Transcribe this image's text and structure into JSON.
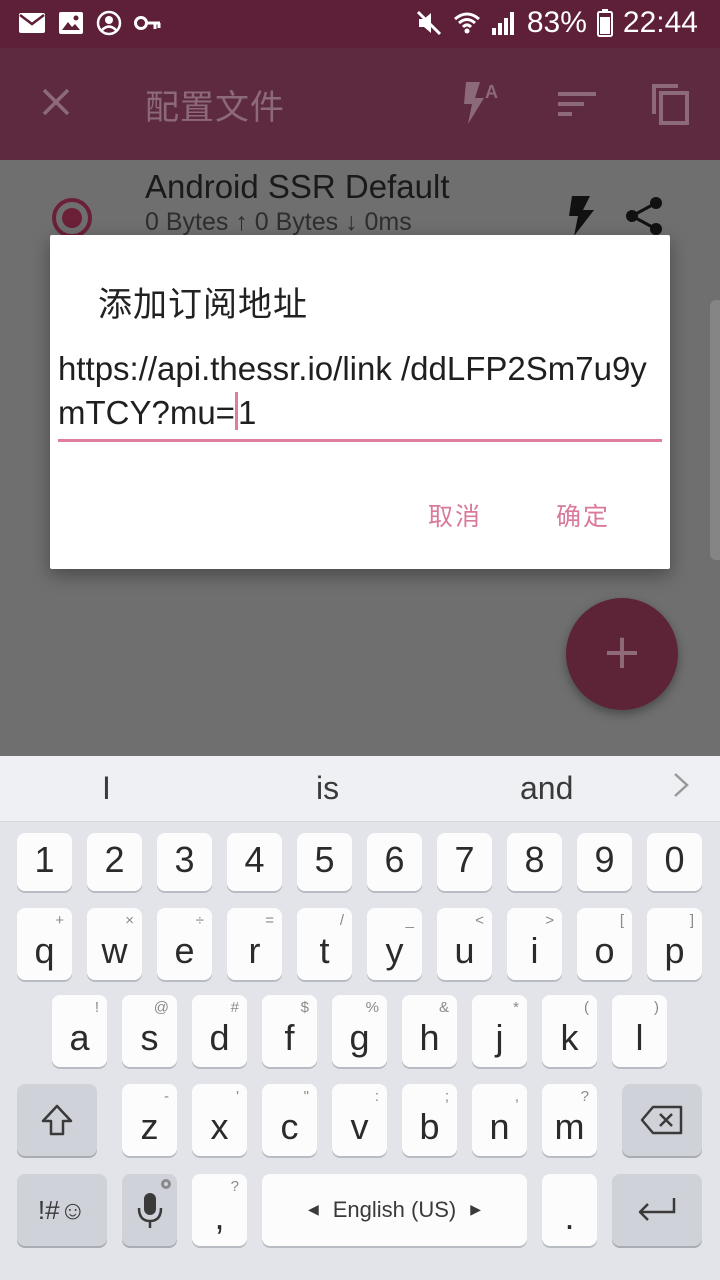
{
  "status_bar": {
    "battery": "83%",
    "time": "22:44"
  },
  "app_bar": {
    "title": "配置文件"
  },
  "profile": {
    "name": "Android SSR Default",
    "stats": "0 Bytes ↑ 0 Bytes ↓ 0ms"
  },
  "dialog": {
    "title": "添加订阅地址",
    "input_value": "https://api.thessr.io/link/ddLFP2Sm7u9ymTCY?mu=1",
    "input_before_cursor": "https://api.thessr.io/link /ddLFP2Sm7u9ymTCY?mu=",
    "input_after_cursor": "1",
    "cancel_label": "取消",
    "ok_label": "确定"
  },
  "fab": {
    "label": "+"
  },
  "keyboard": {
    "suggestions": [
      "I",
      "is",
      "and"
    ],
    "number_row": [
      "1",
      "2",
      "3",
      "4",
      "5",
      "6",
      "7",
      "8",
      "9",
      "0"
    ],
    "row1": [
      {
        "key": "q",
        "hint": "+"
      },
      {
        "key": "w",
        "hint": "×"
      },
      {
        "key": "e",
        "hint": "÷"
      },
      {
        "key": "r",
        "hint": "="
      },
      {
        "key": "t",
        "hint": "/"
      },
      {
        "key": "y",
        "hint": "_"
      },
      {
        "key": "u",
        "hint": "<"
      },
      {
        "key": "i",
        "hint": ">"
      },
      {
        "key": "o",
        "hint": "["
      },
      {
        "key": "p",
        "hint": "]"
      }
    ],
    "row2": [
      {
        "key": "a",
        "hint": "!"
      },
      {
        "key": "s",
        "hint": "@"
      },
      {
        "key": "d",
        "hint": "#"
      },
      {
        "key": "f",
        "hint": "$"
      },
      {
        "key": "g",
        "hint": "%"
      },
      {
        "key": "h",
        "hint": "&"
      },
      {
        "key": "j",
        "hint": "*"
      },
      {
        "key": "k",
        "hint": "("
      },
      {
        "key": "l",
        "hint": ")"
      }
    ],
    "row3": [
      {
        "key": "z",
        "hint": "-"
      },
      {
        "key": "x",
        "hint": "'"
      },
      {
        "key": "c",
        "hint": "\""
      },
      {
        "key": "v",
        "hint": ":"
      },
      {
        "key": "b",
        "hint": ";"
      },
      {
        "key": "n",
        "hint": ","
      },
      {
        "key": "m",
        "hint": "?"
      }
    ],
    "symbols_label": "!#☺",
    "comma_label": ",",
    "comma_hint": "?",
    "space_label": "English (US)",
    "period_label": "."
  },
  "colors": {
    "status_bar": "#5e1f39",
    "accent": "#e07ca0",
    "dialog_button": "#d97a9c"
  }
}
